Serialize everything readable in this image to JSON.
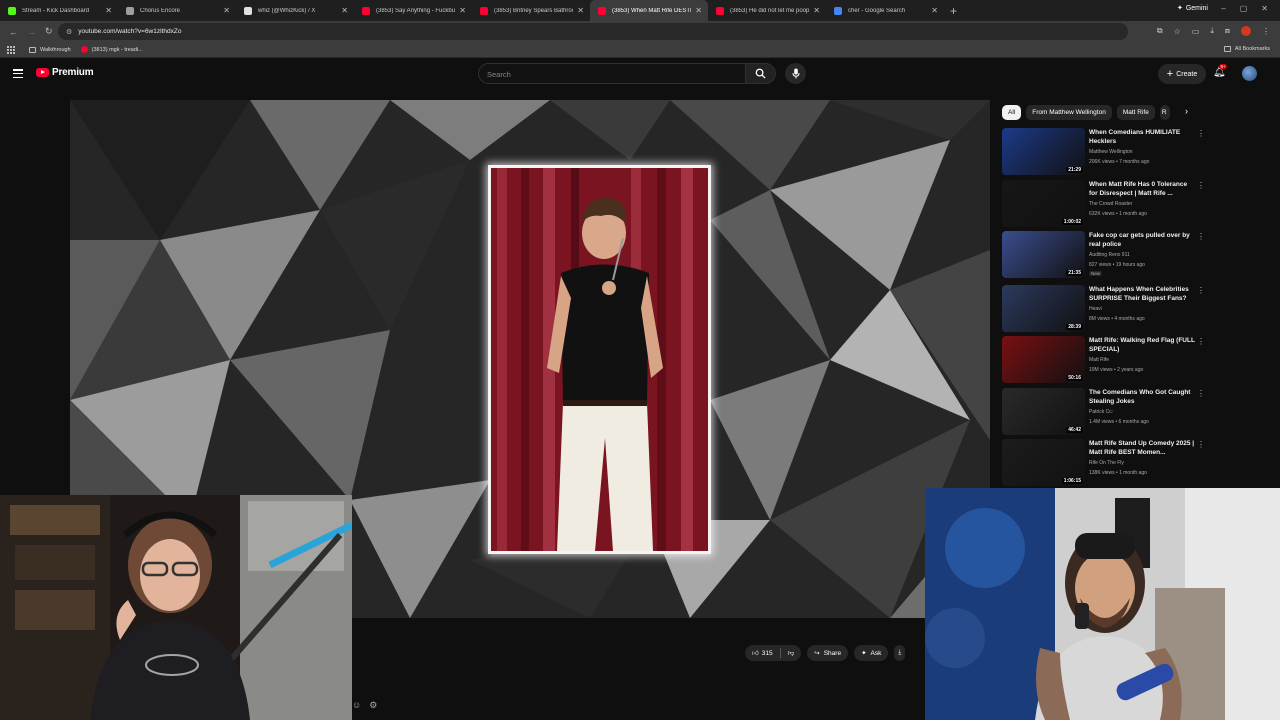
{
  "browser": {
    "tabs": [
      {
        "title": "Stream - Kick Dashboard",
        "favicon_color": "#53fc18",
        "active": false
      },
      {
        "title": "Chorus Encore",
        "favicon_color": "#9e9e9e",
        "active": false
      },
      {
        "title": "whiz (@WhizKick) / X",
        "favicon_color": "#e0e0e0",
        "active": false
      },
      {
        "title": "(3853) Say Anything - Fuckbud",
        "favicon_color": "#ff0033",
        "active": false
      },
      {
        "title": "(3853) Britney Spears Bathroom",
        "favicon_color": "#ff0033",
        "active": false
      },
      {
        "title": "(3853) When Matt Rife DESTR",
        "favicon_color": "#ff0033",
        "active": true
      },
      {
        "title": "(3853) He did not let me poop",
        "favicon_color": "#ff0033",
        "active": false
      },
      {
        "title": "cher - Google Search",
        "favicon_color": "#4285f4",
        "active": false
      }
    ],
    "gemini_label": "Gemini",
    "url": "youtube.com/watch?v=6w1zlthdxZo",
    "bookmarks": [
      {
        "label": "Walkthrough",
        "icon": "folder-icon"
      },
      {
        "label": "(3813) mgk - treadi...",
        "icon": "youtube-icon"
      }
    ],
    "all_bookmarks_label": "All Bookmarks"
  },
  "youtube": {
    "logo_text": "Premium",
    "search_placeholder": "Search",
    "create_label": "Create",
    "notification_count": "9+"
  },
  "player": {
    "like_count": "315",
    "share_label": "Share",
    "ask_label": "Ask"
  },
  "chips": [
    "All",
    "From Matthew Wellington",
    "Matt Rife",
    "R"
  ],
  "recommendations": [
    {
      "title": "When Comedians HUMILIATE Hecklers",
      "channel": "Matthew Wellington",
      "meta": "206K views • 7 months ago",
      "duration": "21:29",
      "thumb_color": "#1d3a8a",
      "badge": ""
    },
    {
      "title": "When Matt Rife Has 0 Tolerance for Disrespect | Matt Rife ...",
      "channel": "The Crowd Roaster",
      "meta": "632K views • 1 month ago",
      "duration": "1:00:02",
      "thumb_color": "#161616",
      "badge": ""
    },
    {
      "title": "Fake cop car gets pulled over by real police",
      "channel": "Auditing Reno 911",
      "meta": "827 views • 19 hours ago",
      "duration": "21:35",
      "thumb_color": "#3a4d8f",
      "badge": "New"
    },
    {
      "title": "What Happens When Celebrities SURPRISE Their Biggest Fans?",
      "channel": "Heavi",
      "meta": "8M views • 4 months ago",
      "duration": "28:39",
      "thumb_color": "#2b3a5e",
      "badge": ""
    },
    {
      "title": "Matt Rife: Walking Red Flag (FULL SPECIAL)",
      "channel": "Matt Rife",
      "meta": "19M views • 2 years ago",
      "duration": "50:16",
      "thumb_color": "#7a0f12",
      "badge": ""
    },
    {
      "title": "The Comedians Who Got Caught Stealing Jokes",
      "channel": "Patrick Cc:",
      "meta": "1.4M views • 6 months ago",
      "duration": "46:42",
      "thumb_color": "#2a2a2a",
      "badge": ""
    },
    {
      "title": "Matt Rife Stand Up Comedy 2025 | Matt Rife BEST Momen...",
      "channel": "Rife On The Fly",
      "meta": "138K views • 1 month ago",
      "duration": "1:06:15",
      "thumb_color": "#1c1c1c",
      "badge": ""
    }
  ]
}
